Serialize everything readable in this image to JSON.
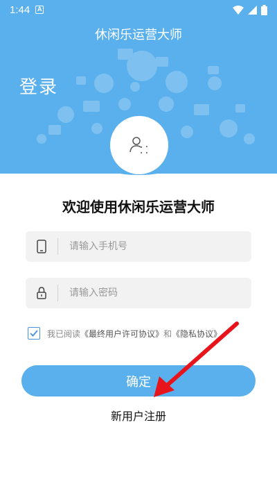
{
  "status_bar": {
    "time": "1:44",
    "notification_glyph": "A",
    "icons": [
      "wifi-icon",
      "signal-icon",
      "battery-icon"
    ]
  },
  "header": {
    "title": "休闲乐运营大师",
    "login_label": "登录",
    "avatar_icon": "user-scan-icon"
  },
  "welcome": "欢迎使用休闲乐运营大师",
  "phone_field": {
    "placeholder": "请输入手机号",
    "value": "",
    "icon": "phone-icon"
  },
  "password_field": {
    "placeholder": "请输入密码",
    "value": "",
    "icon": "lock-icon"
  },
  "agreement": {
    "checked": true,
    "prefix": "我已阅读",
    "terms_link": "《最终用户许可协议》",
    "and": "和",
    "privacy_link": "《隐私协议》"
  },
  "confirm_button": "确定",
  "register_link": "新用户注册",
  "colors": {
    "primary": "#5ab0ec",
    "field_bg": "#f2f2f2",
    "arrow": "#e8141c"
  }
}
